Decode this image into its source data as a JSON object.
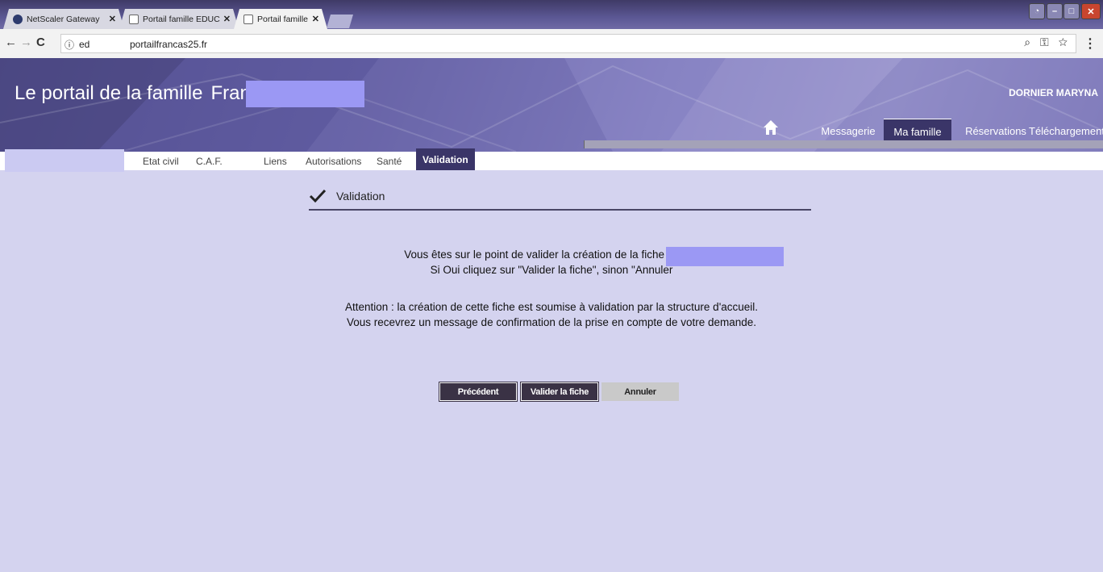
{
  "browser": {
    "tabs": [
      {
        "title": "NetScaler Gateway",
        "active": false
      },
      {
        "title": "Portail famille EDUCATIO",
        "active": false
      },
      {
        "title": "Portail famille EDUCATIO",
        "active": true
      }
    ],
    "address": {
      "secure_icon": "ⓘ",
      "subdomain": "ed",
      "url": "portailfrancas25.fr"
    }
  },
  "header": {
    "title": "Le portail de la famille",
    "brand": "Francas -",
    "user": "DORNIER MARYNA",
    "nav": [
      {
        "label": "Messagerie",
        "active": false
      },
      {
        "label": "Ma famille",
        "active": true
      },
      {
        "label": "Réservations",
        "active": false
      },
      {
        "label": "Téléchargements",
        "active": false
      }
    ]
  },
  "subnav": {
    "tabs": [
      {
        "label": "Etat civil",
        "active": false
      },
      {
        "label": "C.A.F.",
        "active": false
      },
      {
        "label": "Liens",
        "active": false
      },
      {
        "label": "Autorisations",
        "active": false
      },
      {
        "label": "Santé",
        "active": false
      },
      {
        "label": "Validation",
        "active": true
      }
    ]
  },
  "content": {
    "section_title": "Validation",
    "line1": "Vous êtes sur le point de valider la création de la fiche de DO",
    "line2": "Si Oui cliquez sur \"Valider la fiche\", sinon \"Annuler",
    "line3": "Attention : la création de cette fiche est soumise à validation par la structure d'accueil.",
    "line4": "Vous recevrez un message de confirmation de la prise en compte de votre demande."
  },
  "buttons": {
    "previous": "Précédent",
    "validate": "Valider la fiche",
    "cancel": "Annuler"
  },
  "colors": {
    "page_bg": "#d4d3ef",
    "accent": "#3a3568",
    "redaction": "#9b98f4"
  }
}
